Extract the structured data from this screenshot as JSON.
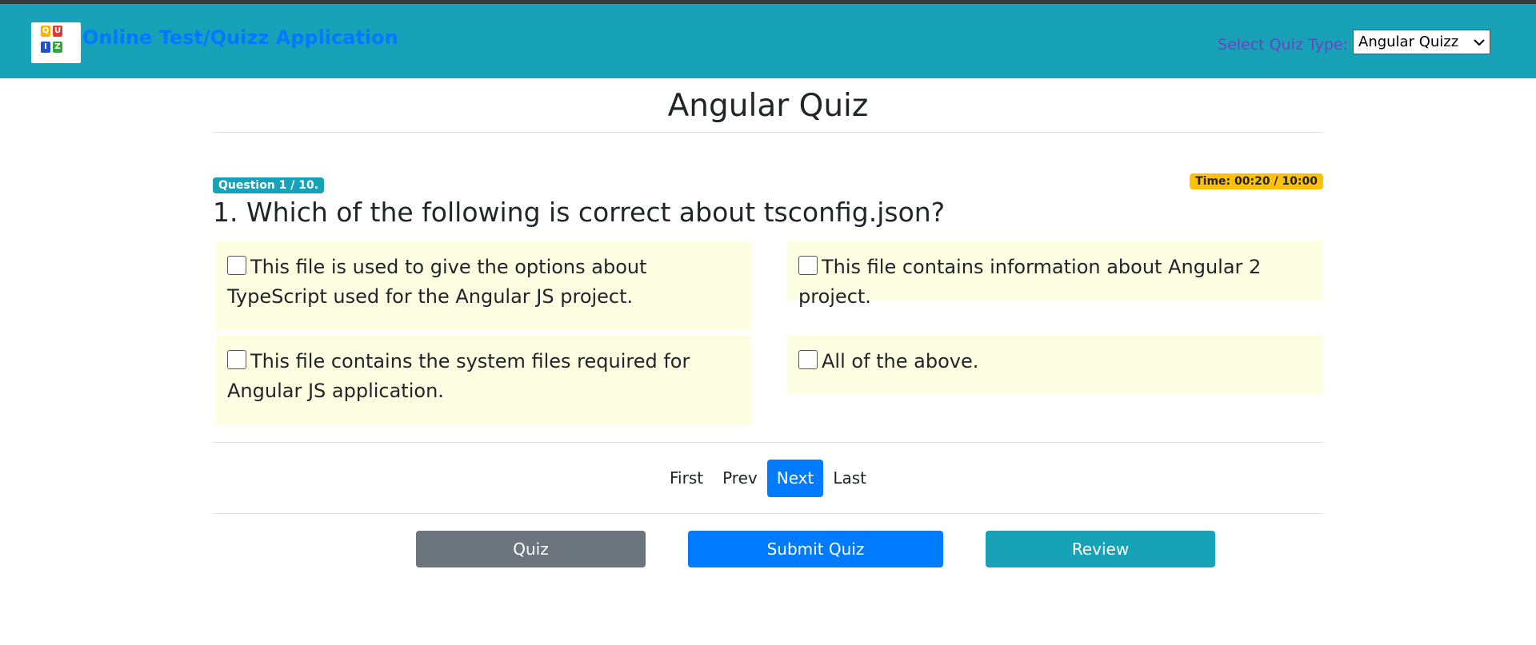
{
  "app": {
    "title": "Online Test/Quizz Application",
    "logo_letters": [
      "Q",
      "U",
      "I",
      "Z"
    ]
  },
  "quiz_type": {
    "label": "Select Quiz Type:",
    "selected": "Angular Quizz"
  },
  "page_title": "Angular Quiz",
  "question": {
    "counter": "Question 1 / 10.",
    "timer": "Time: 00:20 / 10:00",
    "text": "1. Which of the following is correct about tsconfig.json?",
    "options": [
      "This file is used to give the options about TypeScript used for the Angular JS project.",
      "This file contains information about Angular 2 project.",
      "This file contains the system files required for Angular JS application.",
      "All of the above."
    ]
  },
  "pagination": {
    "first": "First",
    "prev": "Prev",
    "next": "Next",
    "last": "Last"
  },
  "actions": {
    "quiz": "Quiz",
    "submit": "Submit Quiz",
    "review": "Review"
  },
  "colors": {
    "navbar": "#17a2b8",
    "primary": "#007bff",
    "secondary": "#6c757d",
    "warning": "#ffc107",
    "option_bg": "#fdfde2"
  }
}
